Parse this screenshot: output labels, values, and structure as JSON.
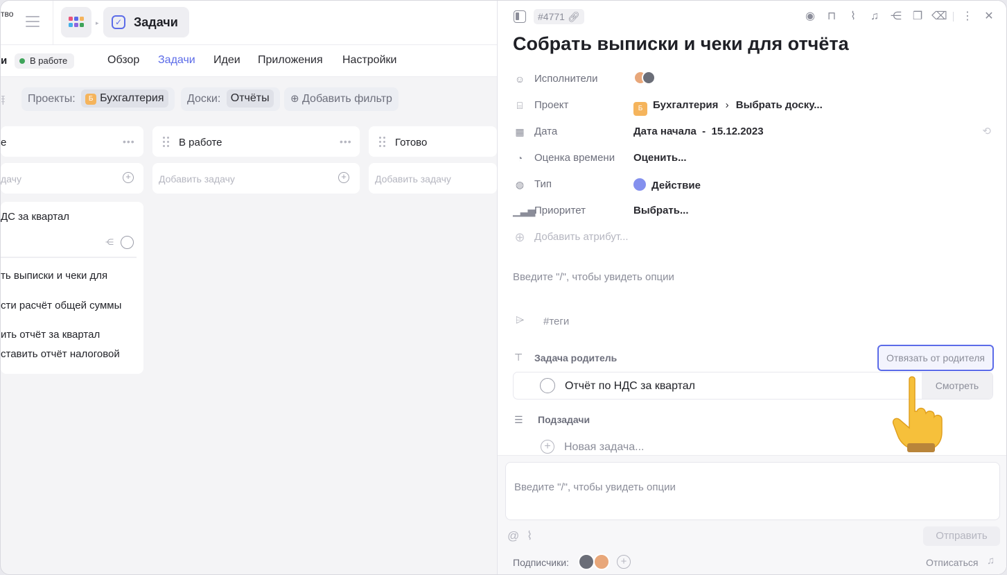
{
  "left": {
    "workspace_cut": "тво",
    "app_tab": {
      "title": "Задачи"
    },
    "nav": {
      "cut_label": "и",
      "status": "В работе",
      "tabs": [
        {
          "label": "Обзор"
        },
        {
          "label": "Задачи"
        },
        {
          "label": "Идеи"
        },
        {
          "label": "Приложения"
        },
        {
          "label": "Настройки"
        }
      ]
    },
    "filters": {
      "projects_label": "Проекты:",
      "project_badge": "Б",
      "project_value": "Бухгалтерия",
      "boards_label": "Доски:",
      "boards_value": "Отчёты",
      "add_filter": "Добавить фильтр"
    },
    "columns": [
      {
        "title": "е",
        "add_placeholder": "дачу"
      },
      {
        "title": "В работе",
        "add_placeholder": "Добавить задачу"
      },
      {
        "title": "Готово",
        "add_placeholder": "Добавить задачу"
      }
    ],
    "card": {
      "title": "ДС за квартал",
      "subtasks": [
        "ть выписки и чеки для",
        "сти расчёт общей суммы",
        "ить отчёт за квартал",
        "ставить отчёт налоговой"
      ]
    }
  },
  "panel": {
    "task_id": "#4771",
    "title": "Собрать выписки и чеки для отчёта",
    "attributes": {
      "assignees_label": "Исполнители",
      "project_label": "Проект",
      "project_badge": "Б",
      "project_value": "Бухгалтерия",
      "project_board": "Выбрать доску...",
      "date_label": "Дата",
      "date_value": "Дата начала  -  15.12.2023",
      "estimate_label": "Оценка времени",
      "estimate_value": "Оценить...",
      "type_label": "Тип",
      "type_value": "Действие",
      "priority_label": "Приоритет",
      "priority_value": "Выбрать...",
      "add_attr": "Добавить атрибут..."
    },
    "editor_placeholder": "Введите \"/\", чтобы увидеть опции",
    "tags_placeholder": "#теги",
    "parent": {
      "label": "Задача родитель",
      "unlink": "Отвязать от родителя",
      "task": "Отчёт по НДС за квартал",
      "view": "Смотреть"
    },
    "subtasks": {
      "label": "Подзадачи",
      "new_task": "Новая задача..."
    },
    "comment": {
      "placeholder": "Введите \"/\", чтобы увидеть опции",
      "send": "Отправить",
      "subscribers_label": "Подписчики:",
      "unsubscribe": "Отписаться"
    }
  },
  "colors": {
    "accent": "#5b6be8",
    "status_green": "#3fa45a",
    "project_orange": "#f5b45c"
  }
}
